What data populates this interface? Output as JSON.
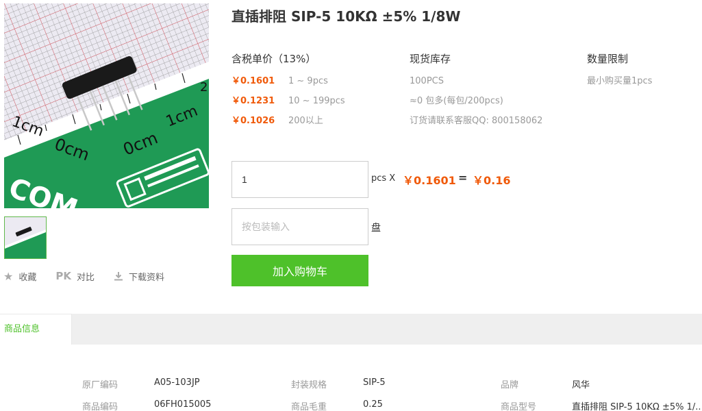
{
  "product": {
    "title": "直插排阻 SIP-5 10KΩ ±5% 1/8W"
  },
  "image": {
    "ruler_left": "1cm",
    "ruler_zero_left": "0cm",
    "ruler_zero_right": "0cm",
    "ruler_right": "1cm",
    "ruler_edge": "2",
    "brand_text": "COM"
  },
  "actions": {
    "favorite": "收藏",
    "pk_icon": "PK",
    "compare": "对比",
    "download": "下载资料"
  },
  "price_table": {
    "header": "含税单价（13%）",
    "rows": [
      {
        "price": "￥0.1601",
        "range": "1 ~ 9pcs"
      },
      {
        "price": "￥0.1231",
        "range": "10 ~ 199pcs"
      },
      {
        "price": "￥0.1026",
        "range": "200以上"
      }
    ]
  },
  "stock": {
    "header": "现货库存",
    "lines": [
      "100PCS",
      "≈0 包多(每包/200pcs)",
      "订货请联系客服QQ: 800158062"
    ]
  },
  "limit": {
    "header": "数量限制",
    "text": "最小购买量1pcs"
  },
  "quantity": {
    "value": "1",
    "unit": "pcs X",
    "unit_price": "￥0.1601",
    "equals": "=",
    "total": "￥0.16"
  },
  "package": {
    "placeholder": "按包装输入",
    "unit": "盘"
  },
  "cart_button": "加入购物车",
  "tabs": {
    "active": "商品信息"
  },
  "specs": [
    {
      "label": "原厂编码",
      "value": "A05-103JP"
    },
    {
      "label": "封装规格",
      "value": "SIP-5"
    },
    {
      "label": "品牌",
      "value": "风华"
    },
    {
      "label": "商品编码",
      "value": "06FH015005"
    },
    {
      "label": "商品毛重",
      "value": "0.25"
    },
    {
      "label": "商品型号",
      "value": "直插排阻 SIP-5 10KΩ ±5% 1/.."
    }
  ],
  "colors": {
    "accent_green": "#4ec12a",
    "price_orange": "#f05a0a"
  }
}
